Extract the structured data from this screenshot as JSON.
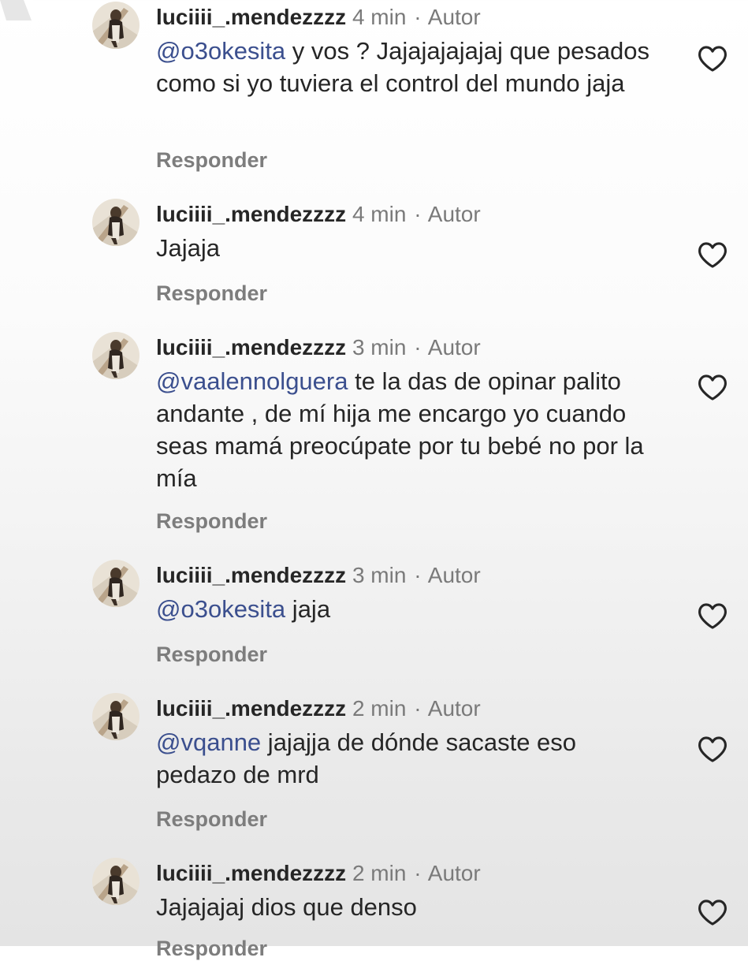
{
  "comments": [
    {
      "username": "luciiii_.mendezzzz",
      "time": "4 min",
      "separator": "·",
      "badge": "Autor",
      "mention": "@o3okesita",
      "text": " y vos ? Jajajajajajaj que pesados como si yo tuviera el control del mundo jaja",
      "reply_label": "Responder"
    },
    {
      "username": "luciiii_.mendezzzz",
      "time": "4 min",
      "separator": "·",
      "badge": "Autor",
      "mention": "",
      "text": "Jajaja",
      "reply_label": "Responder"
    },
    {
      "username": "luciiii_.mendezzzz",
      "time": "3 min",
      "separator": "·",
      "badge": "Autor",
      "mention": "@vaalennolguera",
      "text": " te la das de opinar palito andante , de mí hija me encargo yo cuando seas mamá preocúpate por tu bebé no por la mía",
      "reply_label": "Responder"
    },
    {
      "username": "luciiii_.mendezzzz",
      "time": "3 min",
      "separator": "·",
      "badge": "Autor",
      "mention": "@o3okesita",
      "text": " jaja",
      "reply_label": "Responder"
    },
    {
      "username": "luciiii_.mendezzzz",
      "time": "2 min",
      "separator": "·",
      "badge": "Autor",
      "mention": "@vqanne",
      "text": " jajajja de dónde sacaste eso pedazo de mrd",
      "reply_label": "Responder"
    },
    {
      "username": "luciiii_.mendezzzz",
      "time": "2 min",
      "separator": "·",
      "badge": "Autor",
      "mention": "",
      "text": "Jajajajaj dios que denso",
      "reply_label": "Responder"
    }
  ],
  "icons": {
    "like": "heart-outline-icon",
    "avatar": "profile-photo"
  },
  "colors": {
    "mention": "#3b4f8e",
    "username": "#262626",
    "secondary": "#7a7a7a"
  }
}
